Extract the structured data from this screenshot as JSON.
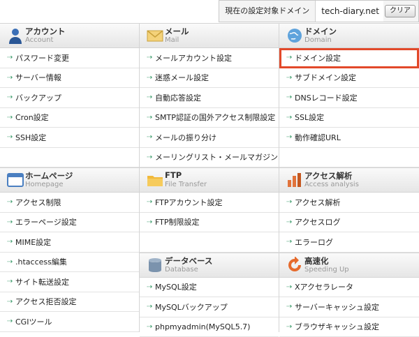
{
  "topbar": {
    "target_label": "現在の設定対象ドメイン",
    "domain": "tech-diary.net",
    "clear_label": "クリア"
  },
  "columns": [
    {
      "sections": [
        {
          "jp": "アカウント",
          "en": "Account",
          "icon": "person-icon",
          "items": [
            "パスワード変更",
            "サーバー情報",
            "バックアップ",
            "Cron設定",
            "SSH設定",
            ""
          ]
        },
        {
          "jp": "ホームページ",
          "en": "Homepage",
          "icon": "browser-window-icon",
          "items": [
            "アクセス制限",
            "エラーページ設定",
            "MIME設定",
            ".htaccess編集",
            "サイト転送設定",
            "アクセス拒否設定",
            "CGIツール"
          ]
        }
      ]
    },
    {
      "sections": [
        {
          "jp": "メール",
          "en": "Mail",
          "icon": "envelope-icon",
          "items": [
            "メールアカウント設定",
            "迷惑メール設定",
            "自動応答設定",
            "SMTP認証の国外アクセス制限設定",
            "メールの振り分け",
            "メーリングリスト・メールマガジン"
          ]
        },
        {
          "jp": "FTP",
          "en": "File Transfer",
          "icon": "folder-icon",
          "items": [
            "FTPアカウント設定",
            "FTP制限設定",
            ""
          ]
        },
        {
          "jp": "データベース",
          "en": "Database",
          "icon": "database-icon",
          "items": [
            "MySQL設定",
            "MySQLバックアップ",
            "phpmyadmin(MySQL5.7)"
          ]
        }
      ]
    },
    {
      "sections": [
        {
          "jp": "ドメイン",
          "en": "Domain",
          "icon": "globe-icon",
          "items": [
            "ドメイン設定",
            "サブドメイン設定",
            "DNSレコード設定",
            "SSL設定",
            "動作確認URL",
            ""
          ]
        },
        {
          "jp": "アクセス解析",
          "en": "Access analysis",
          "icon": "bar-chart-icon",
          "items": [
            "アクセス解析",
            "アクセスログ",
            "エラーログ"
          ]
        },
        {
          "jp": "高速化",
          "en": "Speeding Up",
          "icon": "refresh-arrow-icon",
          "items": [
            "Xアクセラレータ",
            "サーバーキャッシュ設定",
            "ブラウザキャッシュ設定"
          ]
        }
      ]
    }
  ],
  "selected": "ドメイン設定",
  "colors": {
    "accent_arrow": "#3a9a6a",
    "highlight": "#e2492a"
  }
}
